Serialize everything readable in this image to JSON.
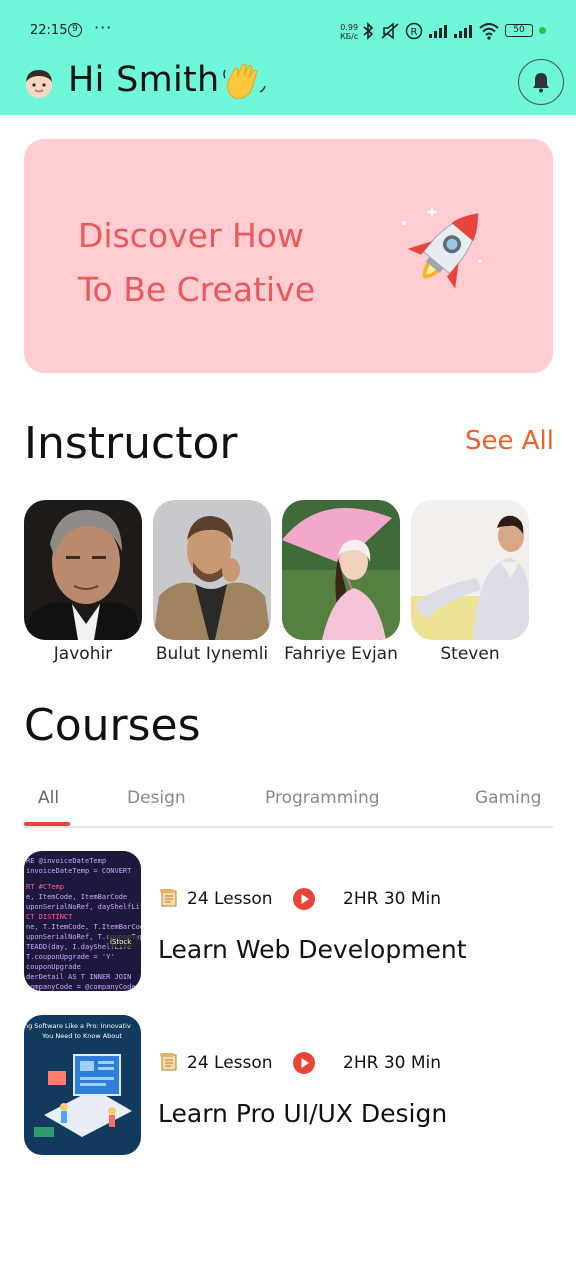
{
  "status_bar": {
    "time": "22:15",
    "dnd_badge": "9",
    "more": "···",
    "speed_value": "0.99",
    "speed_unit": "КБ/с",
    "battery": "50"
  },
  "header": {
    "greeting": "Hi Smith",
    "avatar_icon": "boy-face-icon",
    "wave_icon": "waving-hand-icon",
    "bell_icon": "bell-icon"
  },
  "banner": {
    "line1": "Discover How",
    "line2": "To Be Creative",
    "icon": "rocket-icon",
    "bg_color": "#ffcdd2",
    "text_color": "#e85a5a"
  },
  "instructor_section": {
    "title": "Instructor",
    "see_all": "See All",
    "instructors": [
      {
        "name": "Javohir"
      },
      {
        "name": "Bulut Iynemli"
      },
      {
        "name": "Fahriye Evjan"
      },
      {
        "name": "Steven"
      }
    ]
  },
  "courses_section": {
    "title": "Courses",
    "tabs": [
      "All",
      "Design",
      "Programming",
      "Gaming"
    ],
    "active_tab": "All",
    "courses": [
      {
        "lessons": "24 Lesson",
        "duration": "2HR 30 Min",
        "title": "Learn Web Development"
      },
      {
        "lessons": "24 Lesson",
        "duration": "2HR 30 Min",
        "title": "Learn Pro UI/UX Design",
        "thumb_caption_1": "ng Software Like a Pro: Innovativ",
        "thumb_caption_2": "You Need to Know About"
      }
    ]
  },
  "colors": {
    "header_bg": "#6ef7d8",
    "accent": "#e8622f",
    "tab_underline": "#e8443a"
  }
}
